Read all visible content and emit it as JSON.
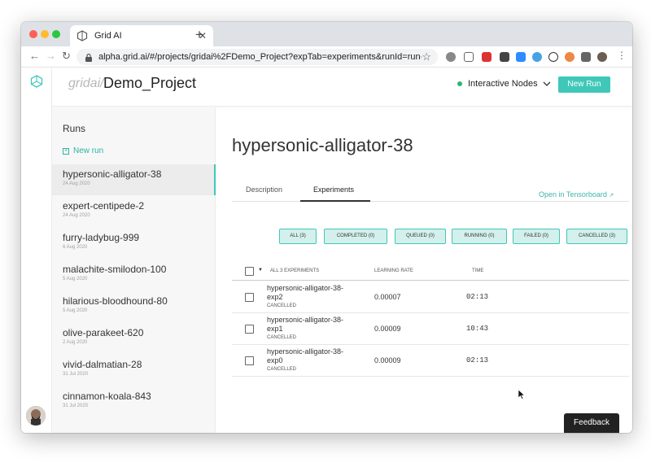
{
  "browser": {
    "tab_title": "Grid AI",
    "url": "alpha.grid.ai/#/projects/gridai%2FDemo_Project?expTab=experiments&runId=run-hyperso..."
  },
  "header": {
    "brand": "gridai/",
    "project": "Demo_Project",
    "nodes_label": "Interactive Nodes",
    "new_run_label": "New Run"
  },
  "sidebar": {
    "title": "Runs",
    "new_run": "New run",
    "runs": [
      {
        "name": "hypersonic-alligator-38",
        "date": "24 Aug 2020"
      },
      {
        "name": "expert-centipede-2",
        "date": "24 Aug 2020"
      },
      {
        "name": "furry-ladybug-999",
        "date": "6 Aug 2020"
      },
      {
        "name": "malachite-smilodon-100",
        "date": "5 Aug 2020"
      },
      {
        "name": "hilarious-bloodhound-80",
        "date": "5 Aug 2020"
      },
      {
        "name": "olive-parakeet-620",
        "date": "2 Aug 2020"
      },
      {
        "name": "vivid-dalmatian-28",
        "date": "31 Jul 2020"
      },
      {
        "name": "cinnamon-koala-843",
        "date": "31 Jul 2020"
      }
    ]
  },
  "main": {
    "run_title": "hypersonic-alligator-38",
    "tabs": {
      "description": "Description",
      "experiments": "Experiments"
    },
    "tensorboard": "Open in Tensorboard",
    "filters": {
      "all": "ALL (3)",
      "completed": "COMPLETED (0)",
      "queued": "QUEUED (0)",
      "running": "RUNNING (0)",
      "failed": "FAILED (0)",
      "cancelled": "CANCELLED (3)"
    },
    "table": {
      "col_experiments": "ALL 3 EXPERIMENTS",
      "col_lr": "LEARNING RATE",
      "col_time": "TIME",
      "rows": [
        {
          "name": "hypersonic-alligator-38-exp2",
          "status": "CANCELLED",
          "lr": "0.00007",
          "time": "02:13"
        },
        {
          "name": "hypersonic-alligator-38-exp1",
          "status": "CANCELLED",
          "lr": "0.00009",
          "time": "10:43"
        },
        {
          "name": "hypersonic-alligator-38-exp0",
          "status": "CANCELLED",
          "lr": "0.00009",
          "time": "02:13"
        }
      ]
    }
  },
  "feedback": "Feedback",
  "colors": {
    "accent": "#3fc8b8",
    "status_green": "#2bb673"
  }
}
